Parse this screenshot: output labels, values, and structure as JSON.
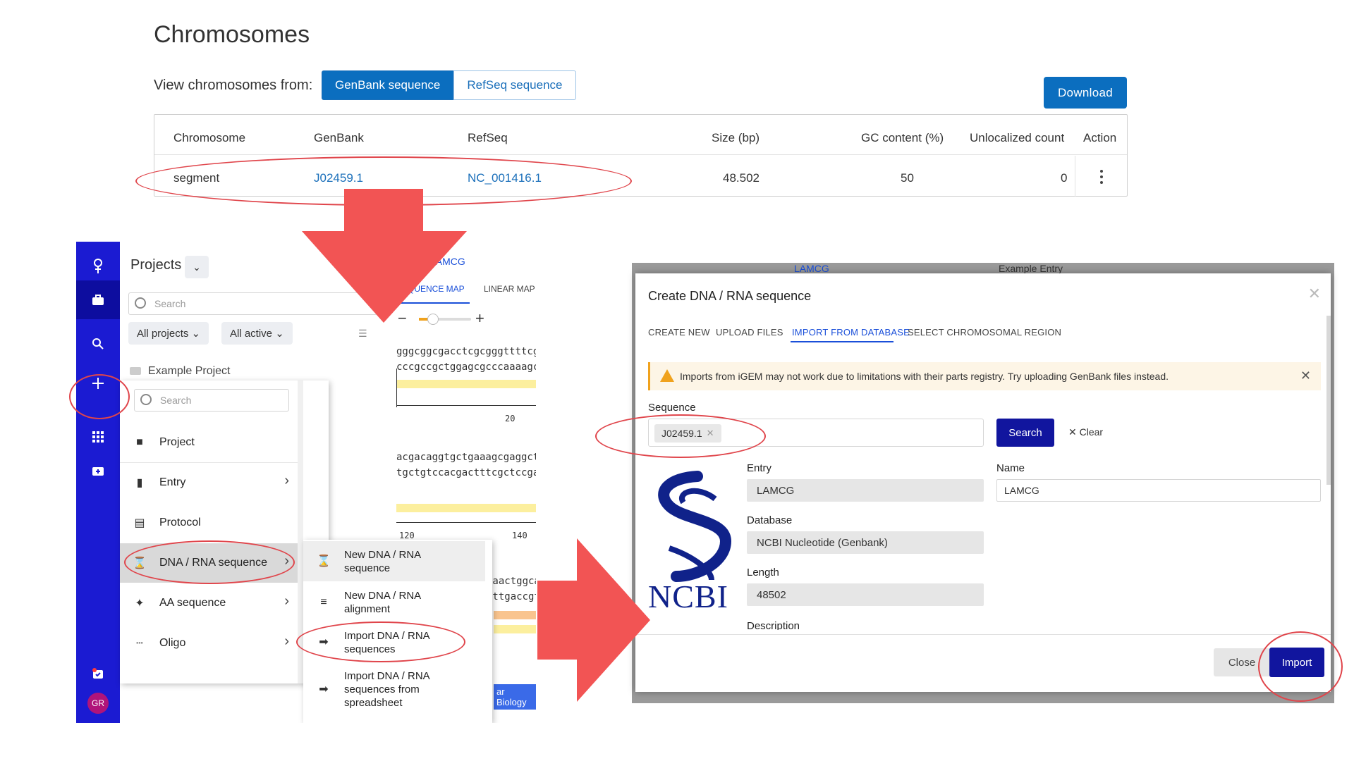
{
  "chromosomes": {
    "title": "Chromosomes",
    "view_from_label": "View chromosomes from:",
    "source_tabs": [
      "GenBank sequence",
      "RefSeq sequence"
    ],
    "active_source": "GenBank sequence",
    "download_label": "Download",
    "columns": [
      "Chromosome",
      "GenBank",
      "RefSeq",
      "Size (bp)",
      "GC content (%)",
      "Unlocalized count",
      "Action"
    ],
    "rows": [
      {
        "chromosome": "segment",
        "genbank": "J02459.1",
        "refseq": "NC_001416.1",
        "size": "48.502",
        "gc": "50",
        "unlocalized": "0"
      }
    ]
  },
  "app": {
    "projects_title": "Projects",
    "search_placeholder": "Search",
    "filter_all_projects": "All projects",
    "filter_all_active": "All active",
    "example_project": "Example Project",
    "avatar_initials": "GR",
    "seq_tab_entry": "LAMCG",
    "seq_view_tabs": [
      "SEQUENCE MAP",
      "LINEAR MAP"
    ],
    "seq_lines": [
      "gggcggcgacctcgcgggttttcg",
      "cccgccgctggagcgcccaaaagc",
      "acgacaggtgctgaaagcgaggct",
      "tgctgtccacgactttcgctccga",
      "caactggca",
      "cttgaccgt"
    ],
    "ruler_labels": [
      "20",
      "120",
      "140"
    ],
    "bottom_tag": "ar Biology",
    "create_menu": {
      "search_placeholder": "Search",
      "items": [
        {
          "label": "Project",
          "icon": "briefcase-icon",
          "has_sub": false
        },
        {
          "label": "Entry",
          "icon": "document-icon",
          "has_sub": true
        },
        {
          "label": "Protocol",
          "icon": "protocol-icon",
          "has_sub": false
        },
        {
          "label": "DNA / RNA sequence",
          "icon": "dna-icon",
          "has_sub": true
        },
        {
          "label": "AA sequence",
          "icon": "aa-icon",
          "has_sub": true
        },
        {
          "label": "Oligo",
          "icon": "oligo-icon",
          "has_sub": true
        }
      ]
    },
    "sub_menu": {
      "items": [
        {
          "line1": "New DNA / RNA",
          "line2": "sequence",
          "line3": ""
        },
        {
          "line1": "New DNA / RNA",
          "line2": "alignment",
          "line3": ""
        },
        {
          "line1": "Import DNA / RNA",
          "line2": "sequences",
          "line3": ""
        },
        {
          "line1": "Import DNA / RNA",
          "line2": "sequences from",
          "line3": "spreadsheet"
        }
      ]
    }
  },
  "dialog": {
    "bg_tab_entry": "LAMCG",
    "bg_tab_example": "Example Entry",
    "title": "Create DNA / RNA sequence",
    "tabs": [
      "CREATE NEW",
      "UPLOAD FILES",
      "IMPORT FROM DATABASE",
      "SELECT CHROMOSOMAL REGION"
    ],
    "active_tab": "IMPORT FROM DATABASE",
    "warning": "Imports from iGEM may not work due to limitations with their parts registry. Try uploading GenBank files instead.",
    "sequence_label": "Sequence",
    "sequence_chip": "J02459.1",
    "search_label": "Search",
    "clear_label": "Clear",
    "logo_text": "NCBI",
    "fields": {
      "entry_label": "Entry",
      "entry_value": "LAMCG",
      "name_label": "Name",
      "name_value": "LAMCG",
      "database_label": "Database",
      "database_value": "NCBI Nucleotide (Genbank)",
      "length_label": "Length",
      "length_value": "48502",
      "description_label": "Description"
    },
    "close_label": "Close",
    "import_label": "Import"
  },
  "colors": {
    "accent_blue": "#0b6ebf",
    "rail_blue": "#1b1bd2",
    "dark_button": "#11159e",
    "annotation_red": "#e0454b",
    "arrow_red": "#f25454"
  }
}
